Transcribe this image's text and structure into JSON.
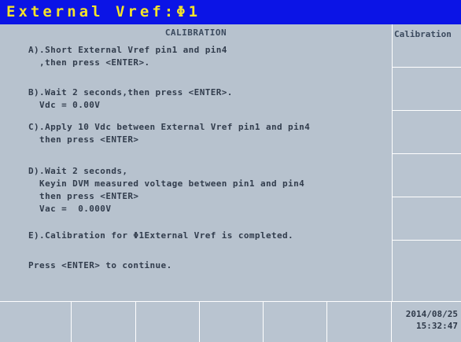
{
  "title": "External Vref:Φ1",
  "main": {
    "header": "CALIBRATION",
    "lines": [
      "A).Short External Vref pin1 and pin4",
      "  ,then press <ENTER>.",
      "B).Wait 2 seconds,then press <ENTER>.",
      "  Vdc = 0.00V",
      "C).Apply 10 Vdc between External Vref pin1 and pin4",
      "  then press <ENTER>",
      "D).Wait 2 seconds,",
      "  Keyin DVM measured voltage between pin1 and pin4",
      "  then press <ENTER>",
      "  Vac =  0.000V",
      "E).Calibration for Φ1External Vref is completed.",
      "Press <ENTER> to continue."
    ]
  },
  "softkeys": [
    "Calibration",
    "",
    "",
    "",
    "",
    ""
  ],
  "bottom_keys": [
    "",
    "",
    "",
    "",
    "",
    ""
  ],
  "datetime": {
    "date": "2014/08/25",
    "time": "15:32:47"
  }
}
